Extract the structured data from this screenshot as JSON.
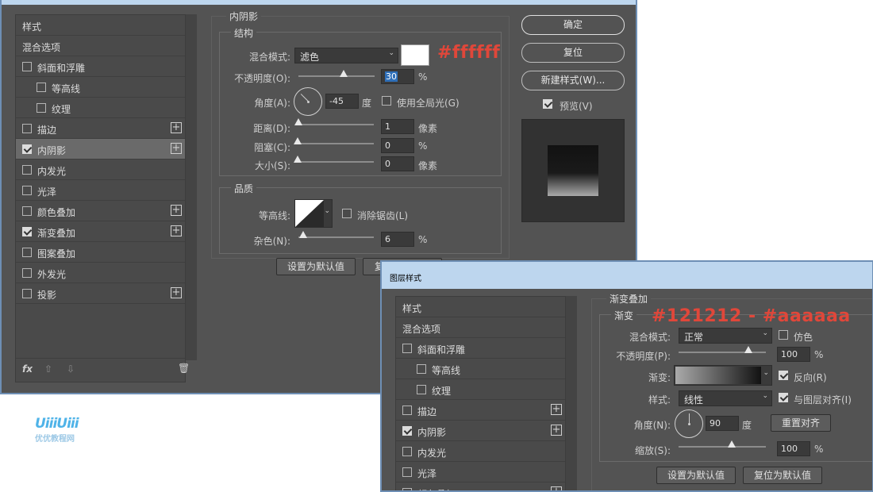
{
  "colors": {
    "annotation": "#e0473a",
    "dialog_bg": "#535353",
    "title_bar": "#bdd6ee",
    "swatch_white": "#ffffff"
  },
  "watermark": {
    "logo": "UiiiUiii",
    "text": "优优教程网"
  },
  "dialog1": {
    "list": {
      "header": "样式",
      "items": [
        {
          "label": "混合选项",
          "check": null,
          "plus": false,
          "indent": 0
        },
        {
          "label": "斜面和浮雕",
          "check": false,
          "plus": false,
          "indent": 0
        },
        {
          "label": "等高线",
          "check": false,
          "plus": false,
          "indent": 1
        },
        {
          "label": "纹理",
          "check": false,
          "plus": false,
          "indent": 1
        },
        {
          "label": "描边",
          "check": false,
          "plus": true,
          "indent": 0
        },
        {
          "label": "内阴影",
          "check": true,
          "plus": true,
          "indent": 0,
          "selected": true
        },
        {
          "label": "内发光",
          "check": false,
          "plus": false,
          "indent": 0
        },
        {
          "label": "光泽",
          "check": false,
          "plus": false,
          "indent": 0
        },
        {
          "label": "颜色叠加",
          "check": false,
          "plus": true,
          "indent": 0
        },
        {
          "label": "渐变叠加",
          "check": true,
          "plus": true,
          "indent": 0
        },
        {
          "label": "图案叠加",
          "check": false,
          "plus": false,
          "indent": 0
        },
        {
          "label": "外发光",
          "check": false,
          "plus": false,
          "indent": 0
        },
        {
          "label": "投影",
          "check": false,
          "plus": true,
          "indent": 0
        }
      ],
      "footer": {
        "fx": "fx",
        "up": "⇧",
        "down": "⇩",
        "trash": "🗑"
      }
    },
    "panel": {
      "title": "内阴影",
      "structure": {
        "caption": "结构",
        "blend_mode_label": "混合模式:",
        "blend_mode_value": "滤色",
        "swatch_annotation": "#ffffff",
        "opacity_label": "不透明度(O):",
        "opacity_value": "30",
        "opacity_unit": "%",
        "opacity_level": 30,
        "angle_label": "角度(A):",
        "angle_value": "-45",
        "angle_unit": "度",
        "global_light_label": "使用全局光(G)",
        "distance_label": "距离(D):",
        "distance_value": "1",
        "distance_unit": "像素",
        "choke_label": "阻塞(C):",
        "choke_value": "0",
        "choke_unit": "%",
        "size_label": "大小(S):",
        "size_value": "0",
        "size_unit": "像素"
      },
      "quality": {
        "caption": "品质",
        "contour_label": "等高线:",
        "anti_alias_label": "消除锯齿(L)",
        "noise_label": "杂色(N):",
        "noise_value": "6",
        "noise_unit": "%"
      },
      "default_button": "设置为默认值",
      "reset_button_partial": "复"
    },
    "buttons": {
      "ok": "确定",
      "reset": "复位",
      "new_style": "新建样式(W)...",
      "preview": "预览(V)"
    }
  },
  "dialog2": {
    "title": "图层样式",
    "list": {
      "header": "样式",
      "items": [
        {
          "label": "混合选项",
          "check": null,
          "plus": false,
          "indent": 0
        },
        {
          "label": "斜面和浮雕",
          "check": false,
          "plus": false,
          "indent": 0
        },
        {
          "label": "等高线",
          "check": false,
          "plus": false,
          "indent": 1
        },
        {
          "label": "纹理",
          "check": false,
          "plus": false,
          "indent": 1
        },
        {
          "label": "描边",
          "check": false,
          "plus": true,
          "indent": 0
        },
        {
          "label": "内阴影",
          "check": true,
          "plus": true,
          "indent": 0
        },
        {
          "label": "内发光",
          "check": false,
          "plus": false,
          "indent": 0
        },
        {
          "label": "光泽",
          "check": false,
          "plus": false,
          "indent": 0
        },
        {
          "label": "颜色叠加",
          "check": false,
          "plus": true,
          "indent": 0
        }
      ]
    },
    "panel": {
      "title": "渐变叠加",
      "caption": "渐变",
      "annotation": "#121212 - #aaaaaa",
      "blend_mode_label": "混合模式:",
      "blend_mode_value": "正常",
      "dither_label": "仿色",
      "opacity_label": "不透明度(P):",
      "opacity_value": "100",
      "opacity_unit": "%",
      "gradient_label": "渐变:",
      "reverse_label": "反向(R)",
      "style_label": "样式:",
      "style_value": "线性",
      "align_label": "与图层对齐(I)",
      "angle_label": "角度(N):",
      "angle_value": "90",
      "angle_unit": "度",
      "reset_align_button": "重置对齐",
      "scale_label": "缩放(S):",
      "scale_value": "100",
      "scale_unit": "%",
      "default_button": "设置为默认值",
      "reset_default_button": "复位为默认值"
    }
  }
}
